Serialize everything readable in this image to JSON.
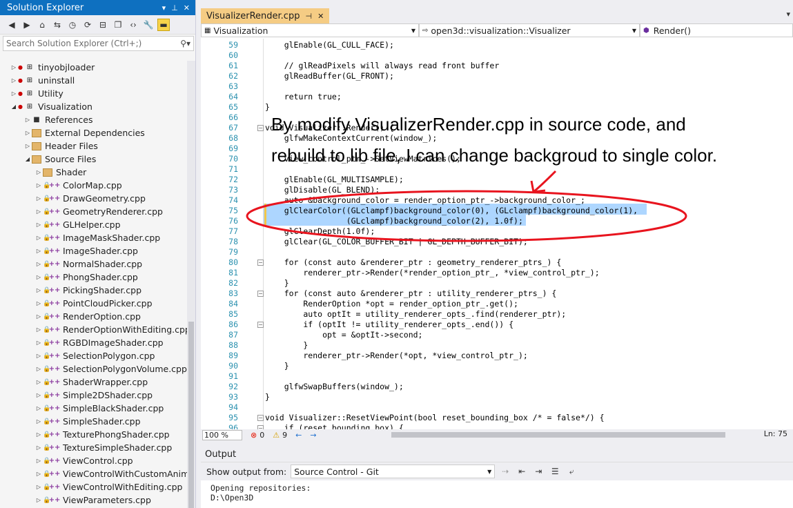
{
  "solution_explorer": {
    "title": "Solution Explorer",
    "search_placeholder": "Search Solution Explorer (Ctrl+;)",
    "tree": [
      {
        "label": "tinyobjloader",
        "kind": "project",
        "indent": 0
      },
      {
        "label": "uninstall",
        "kind": "project",
        "indent": 0
      },
      {
        "label": "Utility",
        "kind": "project",
        "indent": 0
      },
      {
        "label": "Visualization",
        "kind": "project",
        "indent": 0
      },
      {
        "label": "References",
        "kind": "ref",
        "indent": 1
      },
      {
        "label": "External Dependencies",
        "kind": "folder",
        "indent": 1
      },
      {
        "label": "Header Files",
        "kind": "folder",
        "indent": 1
      },
      {
        "label": "Source Files",
        "kind": "folder",
        "indent": 1
      },
      {
        "label": "Shader",
        "kind": "folder",
        "indent": 2
      },
      {
        "label": "ColorMap.cpp",
        "kind": "cpp",
        "indent": 2
      },
      {
        "label": "DrawGeometry.cpp",
        "kind": "cpp",
        "indent": 2
      },
      {
        "label": "GeometryRenderer.cpp",
        "kind": "cpp",
        "indent": 2
      },
      {
        "label": "GLHelper.cpp",
        "kind": "cpp",
        "indent": 2
      },
      {
        "label": "ImageMaskShader.cpp",
        "kind": "cpp",
        "indent": 2
      },
      {
        "label": "ImageShader.cpp",
        "kind": "cpp",
        "indent": 2
      },
      {
        "label": "NormalShader.cpp",
        "kind": "cpp",
        "indent": 2
      },
      {
        "label": "PhongShader.cpp",
        "kind": "cpp",
        "indent": 2
      },
      {
        "label": "PickingShader.cpp",
        "kind": "cpp",
        "indent": 2
      },
      {
        "label": "PointCloudPicker.cpp",
        "kind": "cpp",
        "indent": 2
      },
      {
        "label": "RenderOption.cpp",
        "kind": "cpp",
        "indent": 2
      },
      {
        "label": "RenderOptionWithEditing.cpp",
        "kind": "cpp",
        "indent": 2
      },
      {
        "label": "RGBDImageShader.cpp",
        "kind": "cpp",
        "indent": 2
      },
      {
        "label": "SelectionPolygon.cpp",
        "kind": "cpp",
        "indent": 2
      },
      {
        "label": "SelectionPolygonVolume.cpp",
        "kind": "cpp",
        "indent": 2
      },
      {
        "label": "ShaderWrapper.cpp",
        "kind": "cpp",
        "indent": 2
      },
      {
        "label": "Simple2DShader.cpp",
        "kind": "cpp",
        "indent": 2
      },
      {
        "label": "SimpleBlackShader.cpp",
        "kind": "cpp",
        "indent": 2
      },
      {
        "label": "SimpleShader.cpp",
        "kind": "cpp",
        "indent": 2
      },
      {
        "label": "TexturePhongShader.cpp",
        "kind": "cpp",
        "indent": 2
      },
      {
        "label": "TextureSimpleShader.cpp",
        "kind": "cpp",
        "indent": 2
      },
      {
        "label": "ViewControl.cpp",
        "kind": "cpp",
        "indent": 2
      },
      {
        "label": "ViewControlWithCustomAnima",
        "kind": "cpp",
        "indent": 2
      },
      {
        "label": "ViewControlWithEditing.cpp",
        "kind": "cpp",
        "indent": 2
      },
      {
        "label": "ViewParameters.cpp",
        "kind": "cpp",
        "indent": 2
      }
    ]
  },
  "editor": {
    "tab_label": "VisualizerRender.cpp",
    "nav_project": "Visualization",
    "nav_class": "open3d::visualization::Visualizer",
    "nav_member": "Render()",
    "lines": [
      {
        "n": "59",
        "t": "    glEnable(GL_CULL_FACE);"
      },
      {
        "n": "60",
        "t": ""
      },
      {
        "n": "61",
        "t": "    // glReadPixels will always read front buffer"
      },
      {
        "n": "62",
        "t": "    glReadBuffer(GL_FRONT);"
      },
      {
        "n": "63",
        "t": ""
      },
      {
        "n": "64",
        "t": "    return true;"
      },
      {
        "n": "65",
        "t": "}"
      },
      {
        "n": "66",
        "t": ""
      },
      {
        "n": "67",
        "t": "void Visualizer::Render() {"
      },
      {
        "n": "68",
        "t": "    glfwMakeContextCurrent(window_);"
      },
      {
        "n": "69",
        "t": ""
      },
      {
        "n": "70",
        "t": "    view_control_ptr_->SetViewMatrices();"
      },
      {
        "n": "71",
        "t": ""
      },
      {
        "n": "72",
        "t": "    glEnable(GL_MULTISAMPLE);"
      },
      {
        "n": "73",
        "t": "    glDisable(GL_BLEND);"
      },
      {
        "n": "74",
        "t": "    auto &background_color = render_option_ptr_->background_color_;"
      },
      {
        "n": "75",
        "t": "    glClearColor((GLclampf)background_color(0), (GLclampf)background_color(1),"
      },
      {
        "n": "76",
        "t": "                 (GLclampf)background_color(2), 1.0f);"
      },
      {
        "n": "77",
        "t": "    glClearDepth(1.0f);"
      },
      {
        "n": "78",
        "t": "    glClear(GL_COLOR_BUFFER_BIT | GL_DEPTH_BUFFER_BIT);"
      },
      {
        "n": "79",
        "t": ""
      },
      {
        "n": "80",
        "t": "    for (const auto &renderer_ptr : geometry_renderer_ptrs_) {"
      },
      {
        "n": "81",
        "t": "        renderer_ptr->Render(*render_option_ptr_, *view_control_ptr_);"
      },
      {
        "n": "82",
        "t": "    }"
      },
      {
        "n": "83",
        "t": "    for (const auto &renderer_ptr : utility_renderer_ptrs_) {"
      },
      {
        "n": "84",
        "t": "        RenderOption *opt = render_option_ptr_.get();"
      },
      {
        "n": "85",
        "t": "        auto optIt = utility_renderer_opts_.find(renderer_ptr);"
      },
      {
        "n": "86",
        "t": "        if (optIt != utility_renderer_opts_.end()) {"
      },
      {
        "n": "87",
        "t": "            opt = &optIt->second;"
      },
      {
        "n": "88",
        "t": "        }"
      },
      {
        "n": "89",
        "t": "        renderer_ptr->Render(*opt, *view_control_ptr_);"
      },
      {
        "n": "90",
        "t": "    }"
      },
      {
        "n": "91",
        "t": ""
      },
      {
        "n": "92",
        "t": "    glfwSwapBuffers(window_);"
      },
      {
        "n": "93",
        "t": "}"
      },
      {
        "n": "94",
        "t": ""
      },
      {
        "n": "95",
        "t": "void Visualizer::ResetViewPoint(bool reset_bounding_box /* = false*/) {"
      },
      {
        "n": "96",
        "t": "    if (reset_bounding_box) {"
      }
    ],
    "status": {
      "zoom": "100 %",
      "errors": "0",
      "warnings": "9",
      "line": "Ln: 75"
    }
  },
  "annotation": {
    "line1": "By modify VisualizerRender.cpp in source code, and",
    "line2": "rebuild to lib file, I can change backgroud to single color."
  },
  "output": {
    "title": "Output",
    "show_from_label": "Show output from:",
    "source": "Source Control - Git",
    "text1": "Opening repositories:",
    "text2": "D:\\Open3D"
  },
  "colors": {
    "accent": "#0e70c0",
    "tab_active": "#f5cc84",
    "selection": "#add6ff",
    "annotation_red": "#e8141e"
  }
}
